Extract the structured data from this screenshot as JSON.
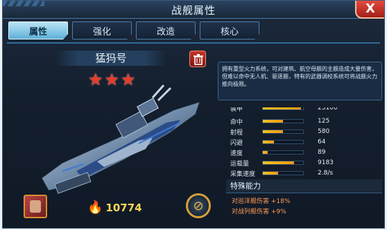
{
  "window": {
    "title": "战舰属性",
    "close_label": "X"
  },
  "tabs": [
    {
      "label": "属性",
      "active": true
    },
    {
      "label": "强化"
    },
    {
      "label": "改造"
    },
    {
      "label": "核心"
    }
  ],
  "ship": {
    "name": "猛犸号",
    "stars": 3,
    "power": "10774"
  },
  "description": "拥有重型火力系统，可对建筑、航空母舰的主舰造成大量伤害，但难以命中无人机、驱逐舰，特有的武器调校系统可将战舰火力推向极限。",
  "stats": [
    {
      "label": "装甲",
      "value": "25100",
      "fraction": 0.95
    },
    {
      "label": "命中",
      "value": "125",
      "fraction": 0.5
    },
    {
      "label": "射程",
      "value": "580",
      "fraction": 0.5
    },
    {
      "label": "闪避",
      "value": "64",
      "fraction": 0.28
    },
    {
      "label": "速度",
      "value": "89",
      "fraction": 0.12
    },
    {
      "label": "运载量",
      "value": "9183",
      "fraction": 0.78
    },
    {
      "label": "采集速度",
      "value": "2.8/s",
      "fraction": 0.38
    }
  ],
  "special": {
    "title": "特殊能力",
    "bonuses": [
      "对巡洋舰伤害 +18%",
      "对战列舰伤害 +9%"
    ]
  },
  "icons": {
    "close": "close-icon",
    "delete": "trash-icon",
    "power": "fire-icon",
    "emblem": "emblem-icon",
    "star": "star-icon"
  },
  "colors": {
    "accent": "#5fb1d8",
    "star": "#e53b2a",
    "bar": "#f7c21e",
    "bonus": "#ff9c55"
  }
}
